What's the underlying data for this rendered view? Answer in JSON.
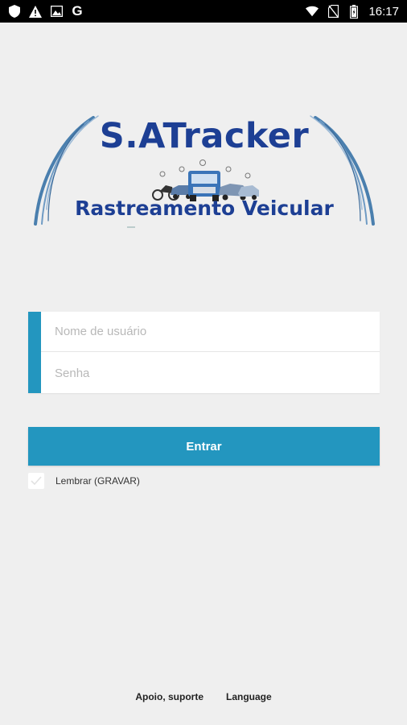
{
  "status_bar": {
    "left_icons": [
      "shield-icon",
      "warning-icon",
      "image-icon",
      "google-g-icon"
    ],
    "google_letter": "G",
    "right_icons": [
      "wifi-icon",
      "no-sim-icon",
      "battery-icon"
    ],
    "time": "16:17"
  },
  "logo": {
    "title": "S.ATracker",
    "subtitle": "Rastreamento Veicular"
  },
  "login_form": {
    "username_placeholder": "Nome de usuário",
    "password_placeholder": "Senha",
    "username_value": "",
    "password_value": ""
  },
  "login_button_label": "Entrar",
  "remember": {
    "label": "Lembrar (GRAVAR)",
    "checked": false
  },
  "footer": {
    "support_link": "Apoio, suporte",
    "language_link": "Language"
  },
  "colors": {
    "accent": "#2396bf",
    "brand_text": "#1d3f94",
    "background": "#efefef"
  }
}
